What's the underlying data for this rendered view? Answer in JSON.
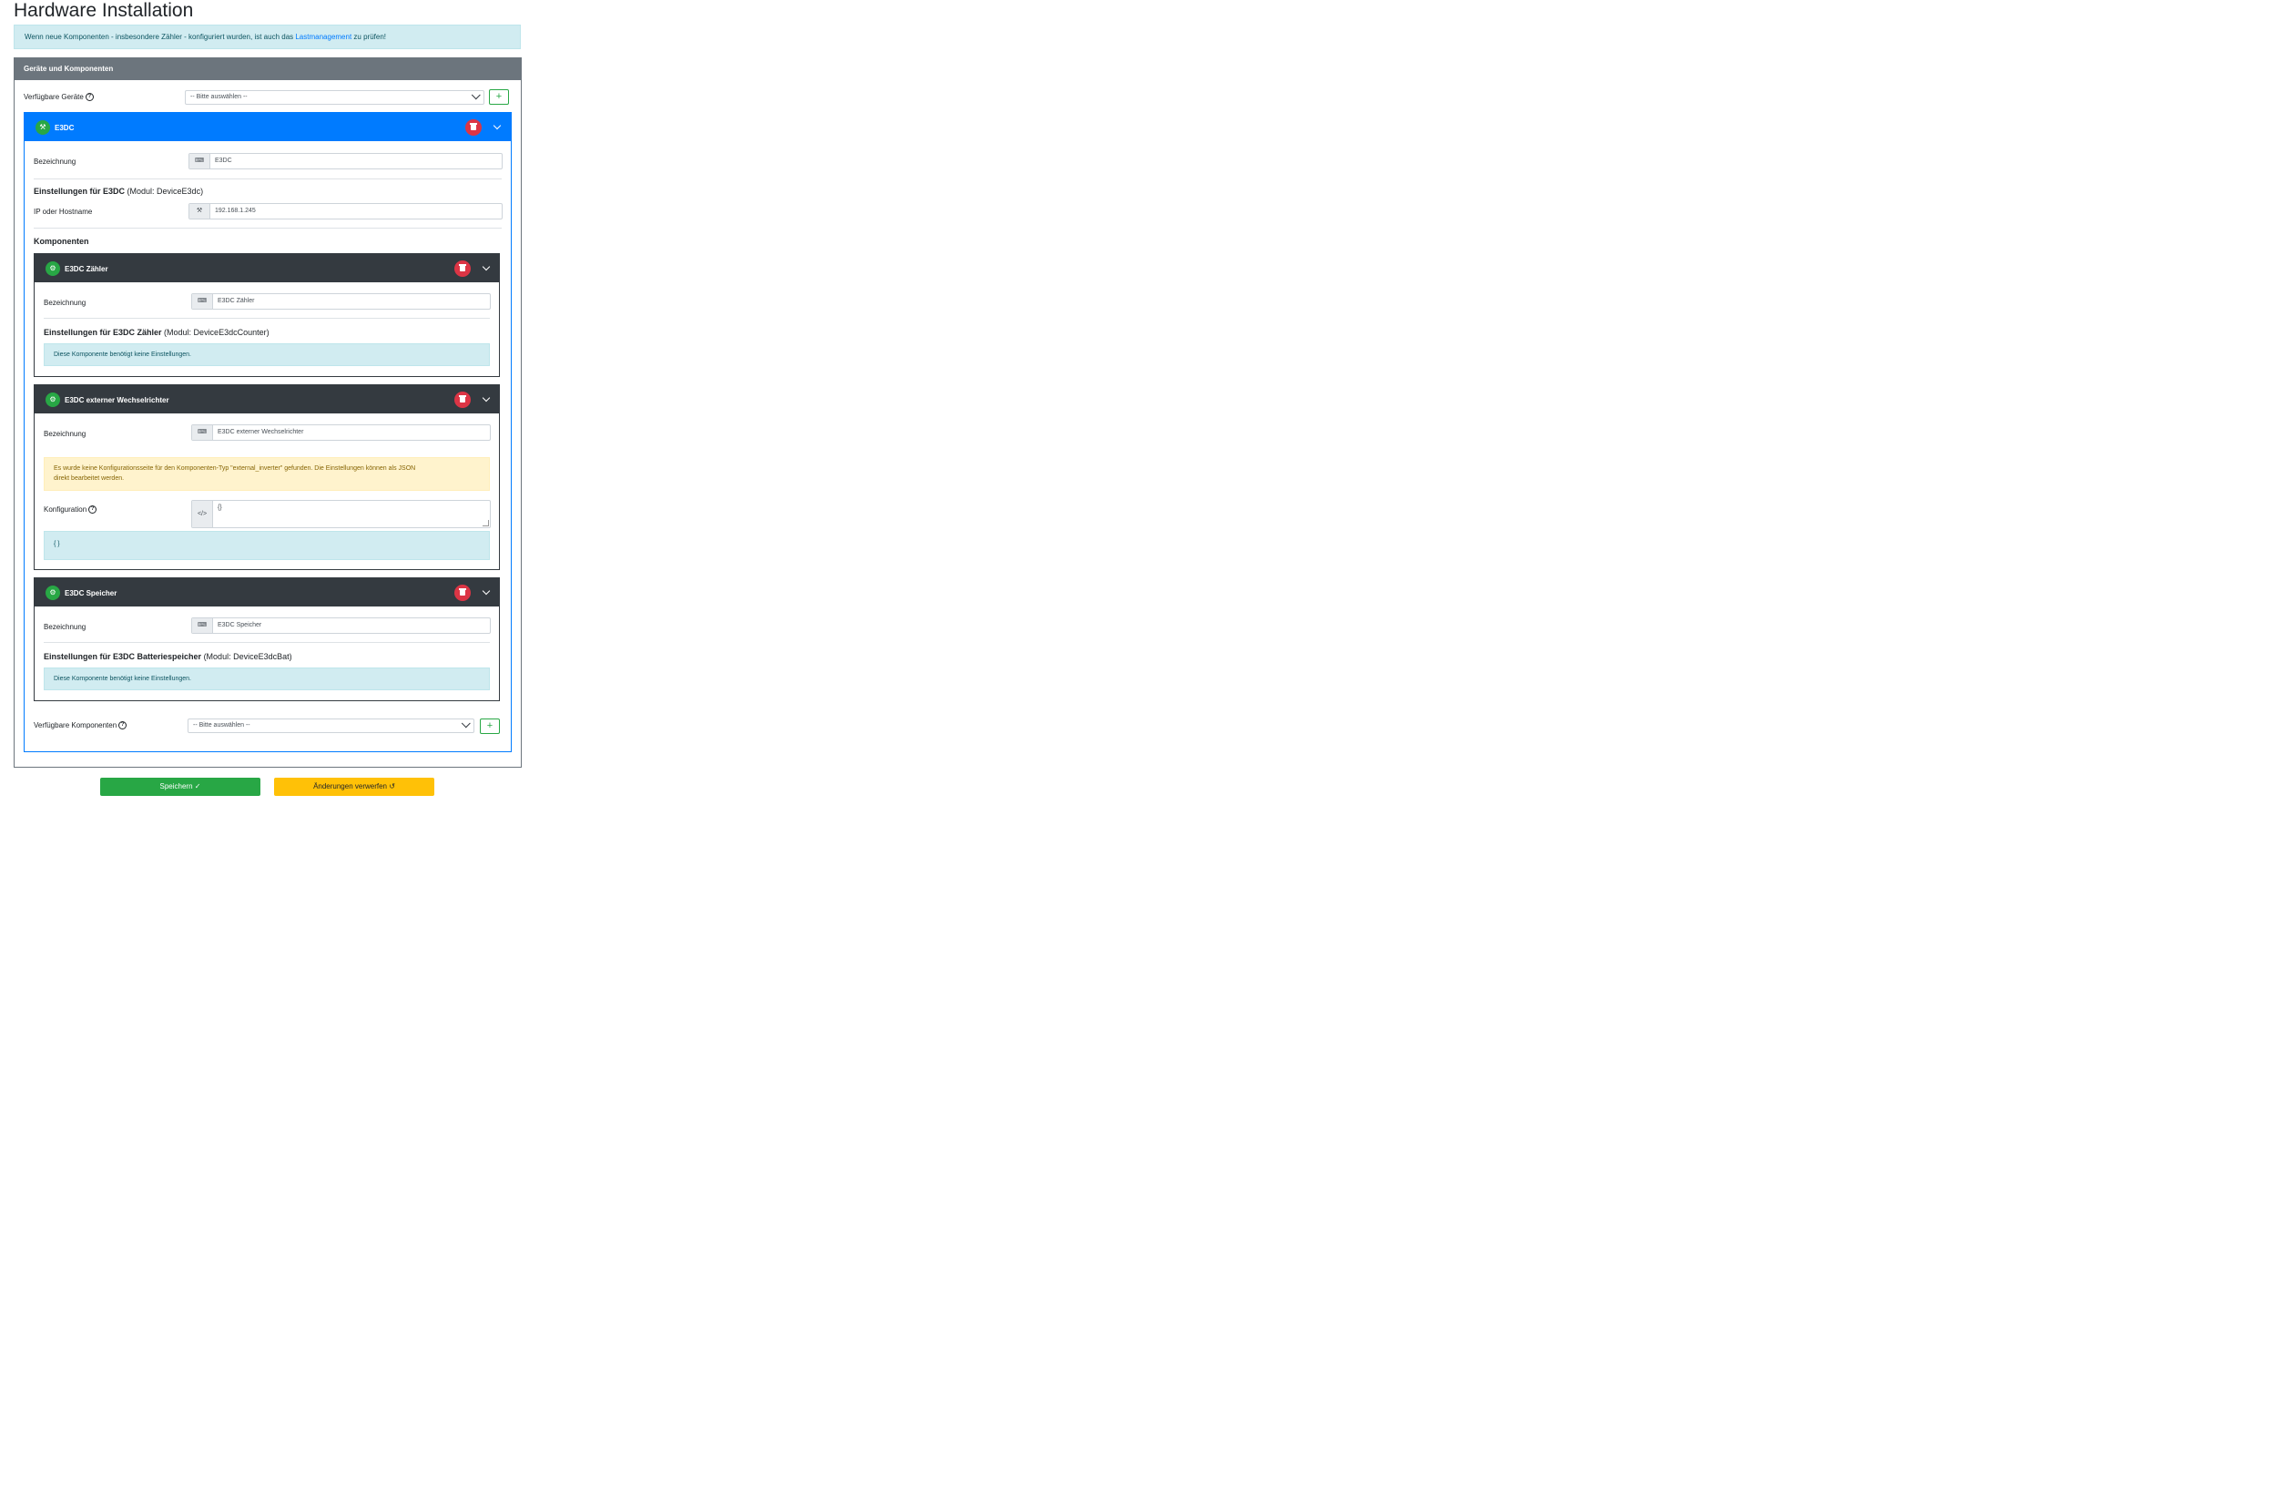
{
  "page": {
    "title": "Hardware Installation"
  },
  "banner": {
    "text_before": "Wenn neue Komponenten - insbesondere Zähler - konfiguriert wurden, ist auch das ",
    "link": "Lastmanagement",
    "text_after": " zu prüfen!"
  },
  "main_card": {
    "header": "Geräte und Komponenten",
    "available_devices_label": "Verfügbare Geräte",
    "available_devices_select": "-- Bitte auswählen --",
    "add_symbol": "+"
  },
  "device": {
    "icon": "network-icon",
    "title": "E3DC",
    "designation_label": "Bezeichnung",
    "designation_value": "E3DC",
    "settings_title": "Einstellungen für E3DC",
    "settings_module": "(Modul: DeviceE3dc)",
    "ip_label": "IP oder Hostname",
    "ip_value": "192.168.1.245",
    "components_title": "Komponenten",
    "available_components_label": "Verfügbare Komponenten",
    "available_components_select": "-- Bitte auswählen --"
  },
  "components": [
    {
      "title": "E3DC Zähler",
      "designation_label": "Bezeichnung",
      "designation_value": "E3DC Zähler",
      "settings_title": "Einstellungen für E3DC Zähler",
      "settings_module": "(Modul: DeviceE3dcCounter)",
      "info": "Diese Komponente benötigt keine Einstellungen."
    },
    {
      "title": "E3DC externer Wechselrichter",
      "designation_label": "Bezeichnung",
      "designation_value": "E3DC externer Wechselrichter",
      "warning_line1": "Es wurde keine Konfigurationsseite für den Komponenten-Typ \"external_inverter\" gefunden. Die Einstellungen können als JSON",
      "warning_line2": "direkt bearbeitet werden.",
      "config_label": "Konfiguration",
      "config_value": "{}",
      "config_preview": "{ }"
    },
    {
      "title": "E3DC Speicher",
      "designation_label": "Bezeichnung",
      "designation_value": "E3DC Speicher",
      "settings_title": "Einstellungen für E3DC Batteriespeicher",
      "settings_module": "(Modul: DeviceE3dcBat)",
      "info": "Diese Komponente benötigt keine Einstellungen."
    }
  ],
  "actions": {
    "save": "Speichern ✓",
    "discard": "Änderungen verwerfen ↺"
  },
  "colors": {
    "primary": "#007bff",
    "success": "#28a745",
    "danger": "#dc3545",
    "warning": "#ffc107",
    "dark": "#343a40",
    "secondary": "#6c757d"
  }
}
